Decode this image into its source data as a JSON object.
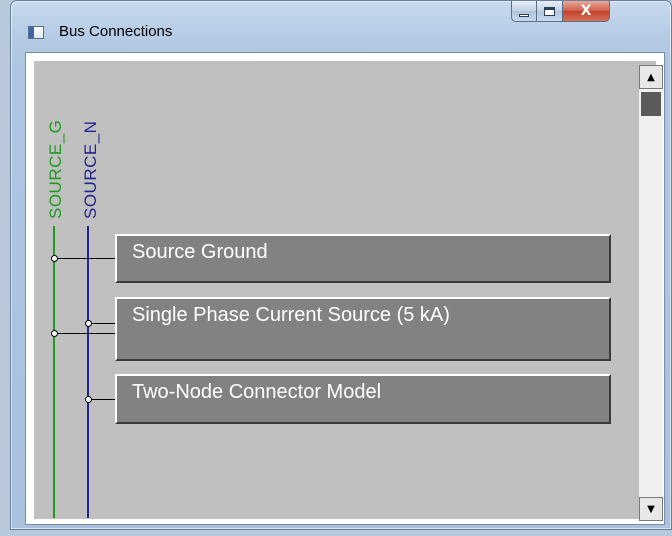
{
  "window": {
    "title": "Bus Connections",
    "icon": "window-app-icon"
  },
  "title_buttons": {
    "minimize_icon": "minimize-icon",
    "maximize_icon": "maximize-icon",
    "close_label": "X"
  },
  "buses": [
    {
      "label": "SOURCE_G",
      "color": "#1e9a1e"
    },
    {
      "label": "SOURCE_N",
      "color": "#23238f"
    }
  ],
  "components": [
    {
      "label": "Source Ground",
      "connected_buses": [
        "SOURCE_G"
      ]
    },
    {
      "label": "Single Phase Current Source (5 kA)",
      "connected_buses": [
        "SOURCE_N",
        "SOURCE_G"
      ]
    },
    {
      "label": "Two-Node Connector Model",
      "connected_buses": [
        "SOURCE_N"
      ]
    }
  ],
  "scrollbar": {
    "up_arrow": "▲",
    "down_arrow": "▼"
  },
  "colors": {
    "canvas_bg": "#c0c0c0",
    "component_bg": "#828282",
    "component_text": "#ffffff"
  }
}
